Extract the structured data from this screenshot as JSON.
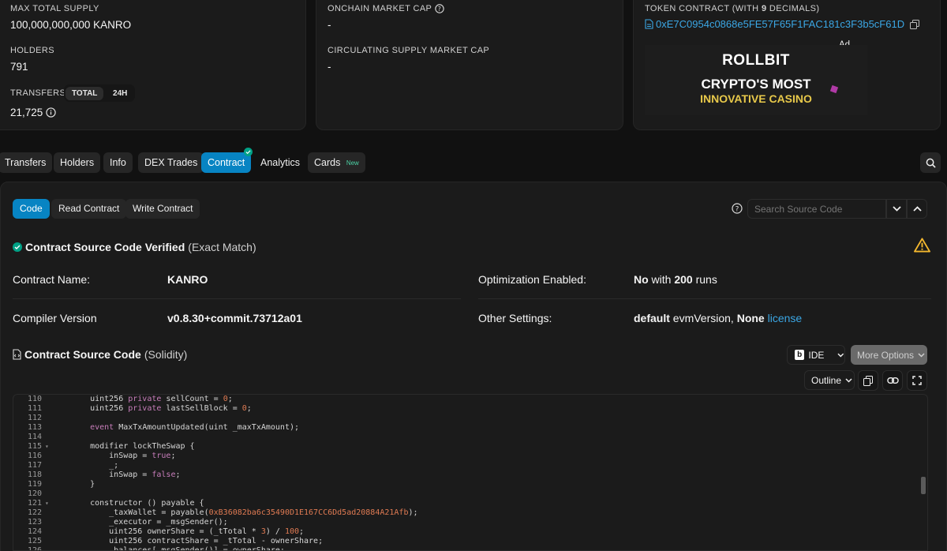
{
  "overview": {
    "max_supply_label": "MAX TOTAL SUPPLY",
    "max_supply_value": "100,000,000,000 KANRO",
    "holders_label": "HOLDERS",
    "holders_value": "791",
    "transfers_label": "TRANSFERS",
    "transfers_tab_total": "TOTAL",
    "transfers_tab_24h": "24H",
    "transfers_value": "21,725"
  },
  "market": {
    "onchain_cap_label": "ONCHAIN MARKET CAP",
    "onchain_cap_value": "-",
    "circ_cap_label": "CIRCULATING SUPPLY MARKET CAP",
    "circ_cap_value": "-"
  },
  "other_info": {
    "token_contract_label_a": "TOKEN CONTRACT (WITH ",
    "token_contract_decimals": "9",
    "token_contract_label_b": " DECIMALS)",
    "token_contract_address": "0xE7C0954c0868e5FE57F65F1FAC181c3F3b5cF61D",
    "ad_label": "Ad",
    "ad_brand": "ROLLBIT",
    "ad_line1": "CRYPTO'S MOST",
    "ad_line2": "INNOVATIVE CASINO"
  },
  "tabs": [
    {
      "label": "Transfers"
    },
    {
      "label": "Holders"
    },
    {
      "label": "Info"
    },
    {
      "label": "DEX Trades"
    },
    {
      "label": "Contract"
    },
    {
      "label": "Analytics"
    },
    {
      "label": "Cards"
    }
  ],
  "cards_badge": "New",
  "contract": {
    "subtabs": [
      "Code",
      "Read Contract",
      "Write Contract"
    ],
    "search_placeholder": "Search Source Code",
    "verified_title": "Contract Source Code Verified",
    "verified_note": "(Exact Match)",
    "name_label": "Contract Name:",
    "name_value": "KANRO",
    "compiler_label": "Compiler Version",
    "compiler_value": "v0.8.30+commit.73712a01",
    "optimization_label": "Optimization Enabled:",
    "optimization_no": "No",
    "optimization_with": " with ",
    "optimization_runs": "200",
    "optimization_runs_suffix": " runs",
    "other_settings_label": "Other Settings:",
    "other_settings_default": "default",
    "other_settings_evm": " evmVersion, ",
    "other_settings_none": "None",
    "other_settings_license": "license",
    "source_title": "Contract Source Code",
    "source_lang": "(Solidity)",
    "ide_label": "IDE",
    "more_options_label": "More Options",
    "outline_label": "Outline"
  },
  "code_lines": [
    {
      "n": "110",
      "fold": false,
      "t": "    uint256 private sellCount = 0;"
    },
    {
      "n": "111",
      "fold": false,
      "t": "    uint256 private lastSellBlock = 0;"
    },
    {
      "n": "112",
      "fold": false,
      "t": ""
    },
    {
      "n": "113",
      "fold": false,
      "t": "    event MaxTxAmountUpdated(uint _maxTxAmount);"
    },
    {
      "n": "114",
      "fold": false,
      "t": ""
    },
    {
      "n": "115",
      "fold": true,
      "t": "    modifier lockTheSwap {"
    },
    {
      "n": "116",
      "fold": false,
      "t": "        inSwap = true;"
    },
    {
      "n": "117",
      "fold": false,
      "t": "        _;"
    },
    {
      "n": "118",
      "fold": false,
      "t": "        inSwap = false;"
    },
    {
      "n": "119",
      "fold": false,
      "t": "    }"
    },
    {
      "n": "120",
      "fold": false,
      "t": ""
    },
    {
      "n": "121",
      "fold": true,
      "t": "    constructor () payable {"
    },
    {
      "n": "122",
      "fold": false,
      "t": "        _taxWallet = payable(0xB36082ba6c35490D1E167CC6Dd5ad20884A21Afb);"
    },
    {
      "n": "123",
      "fold": false,
      "t": "        _executor = _msgSender();"
    },
    {
      "n": "124",
      "fold": false,
      "t": "        uint256 ownerShare = (_tTotal * 3) / 100;"
    },
    {
      "n": "125",
      "fold": false,
      "t": "        uint256 contractShare = _tTotal - ownerShare;"
    },
    {
      "n": "126",
      "fold": false,
      "t": "        _balances[_msgSender()] = ownerShare;"
    }
  ]
}
